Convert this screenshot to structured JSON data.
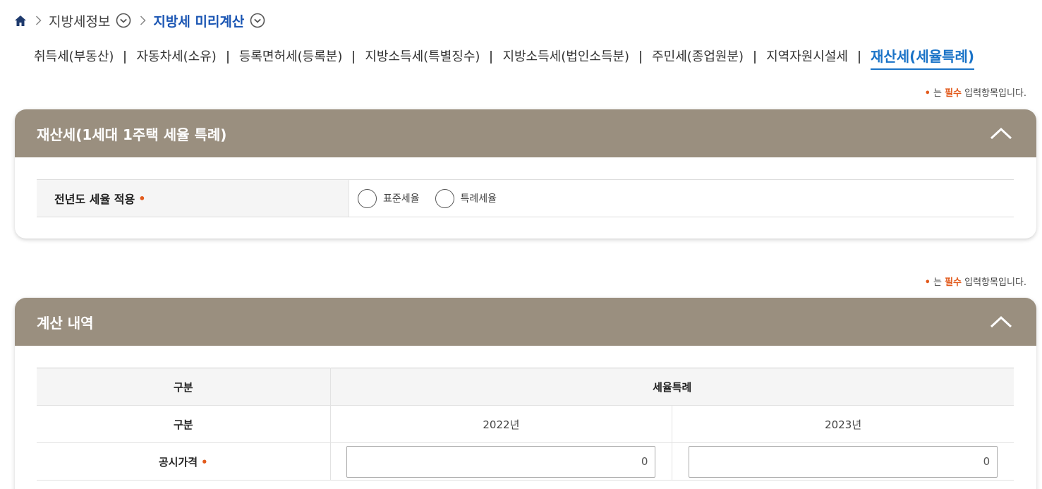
{
  "breadcrumb": {
    "items": [
      "지방세정보",
      "지방세 미리계산"
    ]
  },
  "tabs": [
    "취득세(부동산)",
    "자동차세(소유)",
    "등록면허세(등록분)",
    "지방소득세(특별징수)",
    "지방소득세(법인소득분)",
    "주민세(종업원분)",
    "지역자원시설세",
    "재산세(세율특례)"
  ],
  "required_note": {
    "dot": "•",
    "prefix": "는",
    "required": "필수",
    "suffix": "입력항목입니다."
  },
  "panel1": {
    "title": "재산세(1세대 1주택 세율 특례)",
    "field_label": "전년도 세율 적용",
    "required_dot": "•",
    "options": [
      "표준세율",
      "특례세율"
    ]
  },
  "panel2": {
    "title": "계산 내역",
    "header_col1": "구분",
    "header_col2": "세율특례",
    "sub_label": "구분",
    "years": [
      "2022년",
      "2023년"
    ],
    "row_label": "공시가격",
    "required_dot": "•",
    "values": [
      "0",
      "0"
    ]
  },
  "colors": {
    "accent": "#1a73c7",
    "panel_header": "#9a8f7f",
    "required": "#e25a1c"
  },
  "icons": {
    "home": "home-icon",
    "chevron_right": "chevron-right-icon",
    "dropdown": "chevron-down-circle-icon",
    "collapse": "chevron-up-icon"
  }
}
